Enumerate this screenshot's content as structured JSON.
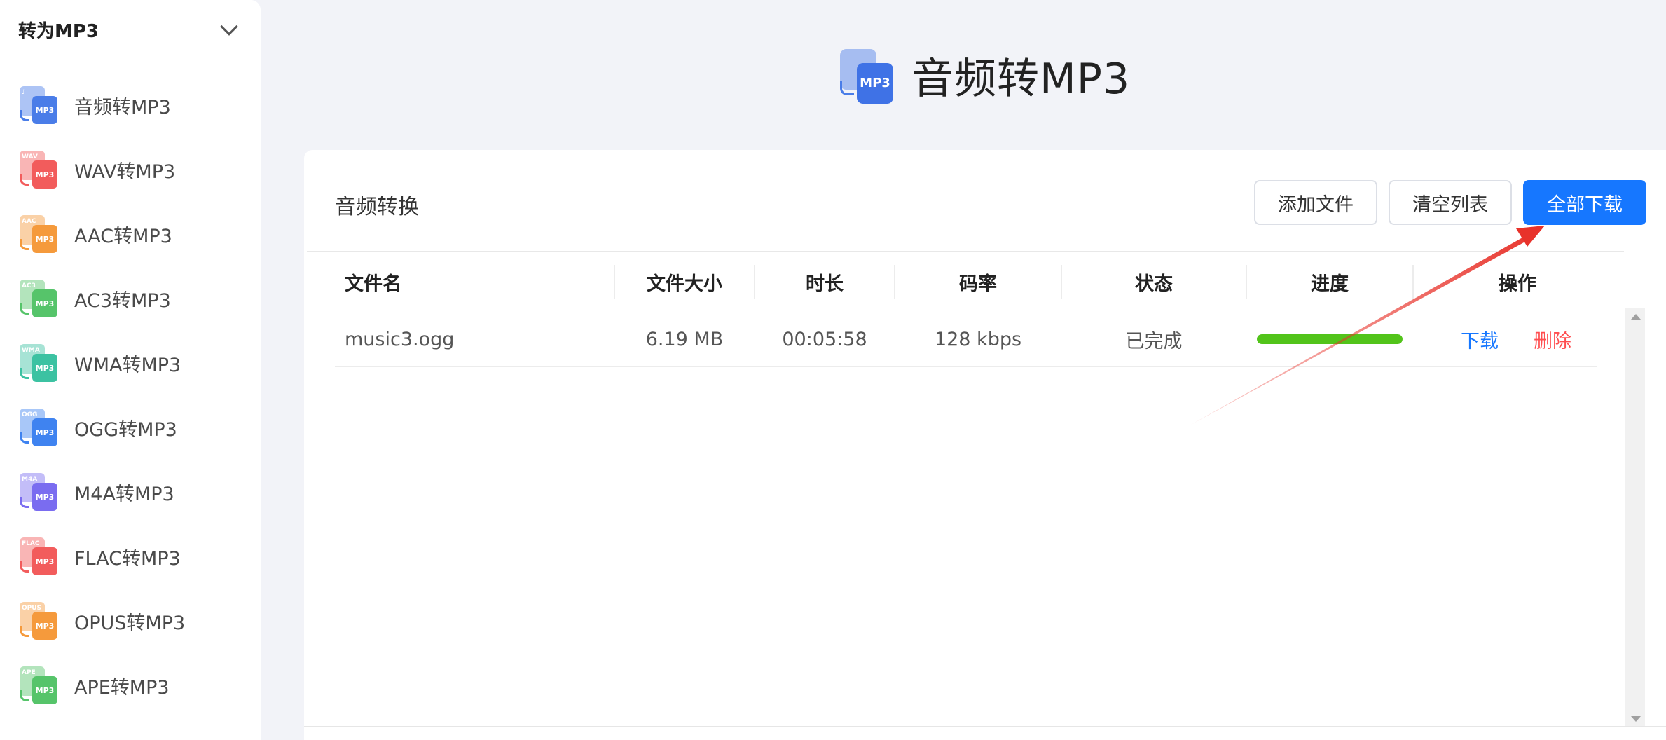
{
  "sidebar": {
    "title": "转为MP3",
    "items": [
      {
        "label": "音频转MP3",
        "tag": "♪",
        "color": "#4a7de8"
      },
      {
        "label": "WAV转MP3",
        "tag": "WAV",
        "color": "#f25c5c"
      },
      {
        "label": "AAC转MP3",
        "tag": "AAC",
        "color": "#f59a3c"
      },
      {
        "label": "AC3转MP3",
        "tag": "AC3",
        "color": "#56c46a"
      },
      {
        "label": "WMA转MP3",
        "tag": "WMA",
        "color": "#3cc2a2"
      },
      {
        "label": "OGG转MP3",
        "tag": "OGG",
        "color": "#3f83f0"
      },
      {
        "label": "M4A转MP3",
        "tag": "M4A",
        "color": "#7a6cf0"
      },
      {
        "label": "FLAC转MP3",
        "tag": "FLAC",
        "color": "#f25c5c"
      },
      {
        "label": "OPUS转MP3",
        "tag": "OPUS",
        "color": "#f59a3c"
      },
      {
        "label": "APE转MP3",
        "tag": "APE",
        "color": "#56c46a"
      }
    ]
  },
  "header": {
    "title": "音频转MP3",
    "icon_text": "MP3",
    "icon": "music-mp3-icon"
  },
  "panel": {
    "title": "音频转换",
    "buttons": {
      "add_file": "添加文件",
      "clear_list": "清空列表",
      "download_all": "全部下载"
    }
  },
  "table": {
    "columns": [
      "文件名",
      "文件大小",
      "时长",
      "码率",
      "状态",
      "进度",
      "操作"
    ],
    "rows": [
      {
        "filename": "music3.ogg",
        "size": "6.19 MB",
        "duration": "00:05:58",
        "bitrate": "128 kbps",
        "status": "已完成",
        "progress": 1.0,
        "action_download": "下载",
        "action_delete": "删除"
      }
    ]
  },
  "colors": {
    "primary": "#1677ff",
    "success": "#52c41a",
    "danger": "#ff4d4f",
    "annotation": "#e8322a"
  }
}
